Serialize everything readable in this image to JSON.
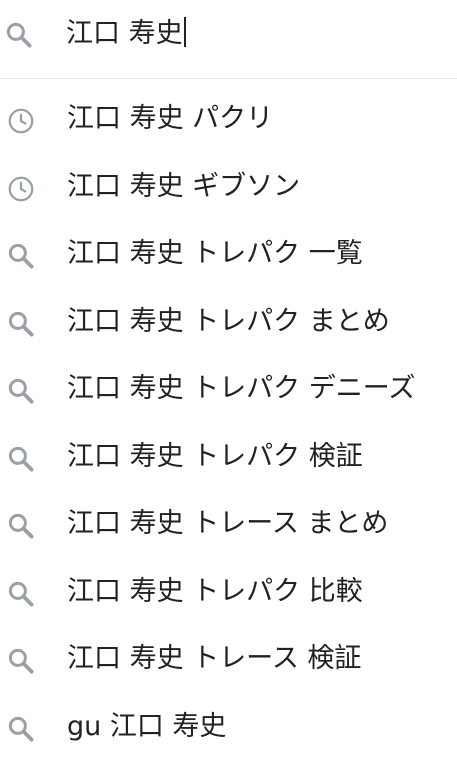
{
  "search": {
    "query": "江口 寿史",
    "icon": "search-icon",
    "icon_color": "#9aa0a6"
  },
  "suggestions": [
    {
      "text": "江口 寿史 パクリ",
      "icon": "history-icon"
    },
    {
      "text": "江口 寿史 ギブソン",
      "icon": "history-icon"
    },
    {
      "text": "江口 寿史 トレパク 一覧",
      "icon": "search-icon"
    },
    {
      "text": "江口 寿史 トレパク まとめ",
      "icon": "search-icon"
    },
    {
      "text": "江口 寿史 トレパク デニーズ",
      "icon": "search-icon"
    },
    {
      "text": "江口 寿史 トレパク 検証",
      "icon": "search-icon"
    },
    {
      "text": "江口 寿史 トレース まとめ",
      "icon": "search-icon"
    },
    {
      "text": "江口 寿史 トレパク 比較",
      "icon": "search-icon"
    },
    {
      "text": "江口 寿史 トレース 検証",
      "icon": "search-icon"
    },
    {
      "text": "gu 江口 寿史",
      "icon": "search-icon"
    }
  ],
  "colors": {
    "text": "#222222",
    "icon": "#9aa0a6",
    "divider": "#e8e8e8"
  }
}
